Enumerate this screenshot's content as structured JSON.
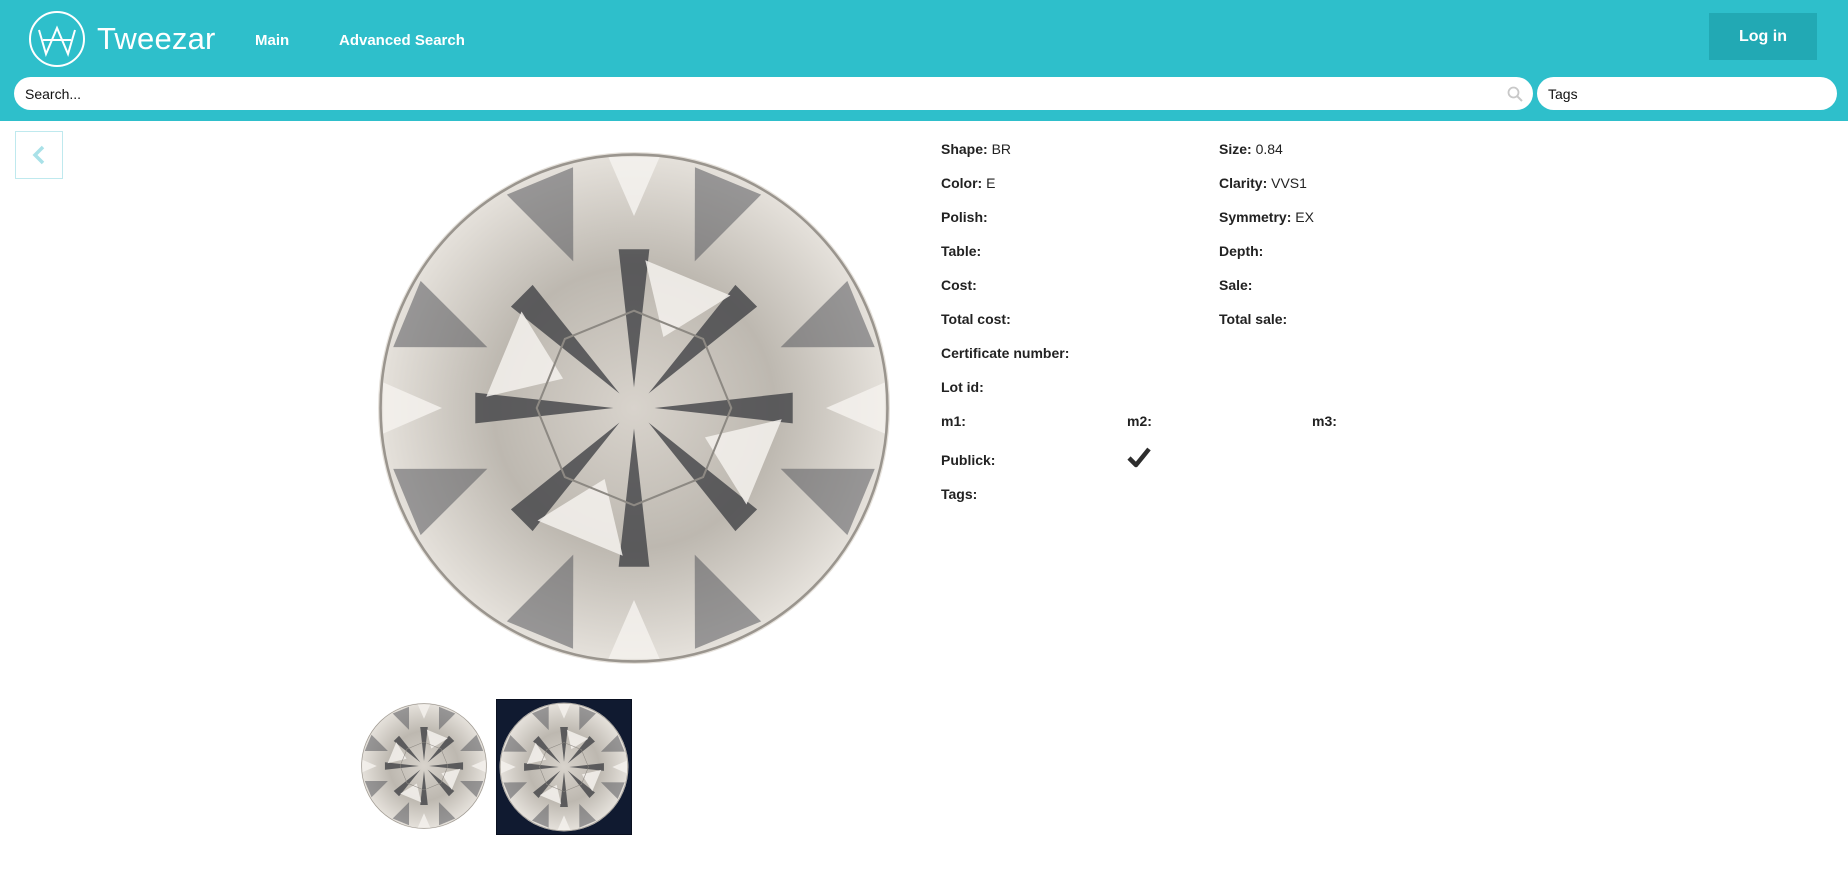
{
  "header": {
    "brand": "Tweezar",
    "nav": {
      "main": "Main",
      "advanced_search": "Advanced Search"
    },
    "login_label": "Log in",
    "search_placeholder": "Search...",
    "tags_placeholder": "Tags",
    "bg_color": "#2ebfcb"
  },
  "details": {
    "shape": {
      "label": "Shape:",
      "value": "BR"
    },
    "size": {
      "label": "Size:",
      "value": "0.84"
    },
    "color": {
      "label": "Color:",
      "value": "E"
    },
    "clarity": {
      "label": "Clarity:",
      "value": "VVS1"
    },
    "polish": {
      "label": "Polish:",
      "value": ""
    },
    "symmetry": {
      "label": "Symmetry:",
      "value": "EX"
    },
    "table": {
      "label": "Table:",
      "value": ""
    },
    "depth": {
      "label": "Depth:",
      "value": ""
    },
    "cost": {
      "label": "Cost:",
      "value": ""
    },
    "sale": {
      "label": "Sale:",
      "value": ""
    },
    "total_cost": {
      "label": "Total cost:",
      "value": ""
    },
    "total_sale": {
      "label": "Total sale:",
      "value": ""
    },
    "certificate_number": {
      "label": "Certificate number:",
      "value": ""
    },
    "lot_id": {
      "label": "Lot id:",
      "value": ""
    },
    "m1": {
      "label": "m1:",
      "value": ""
    },
    "m2": {
      "label": "m2:",
      "value": ""
    },
    "m3": {
      "label": "m3:",
      "value": ""
    },
    "publick": {
      "label": "Publick:",
      "checked": true
    },
    "tags": {
      "label": "Tags:",
      "value": ""
    }
  },
  "icons": {
    "logo": "tweezar-logo-icon",
    "search": "search-icon",
    "back": "chevron-left-icon",
    "check": "checkmark-icon"
  }
}
